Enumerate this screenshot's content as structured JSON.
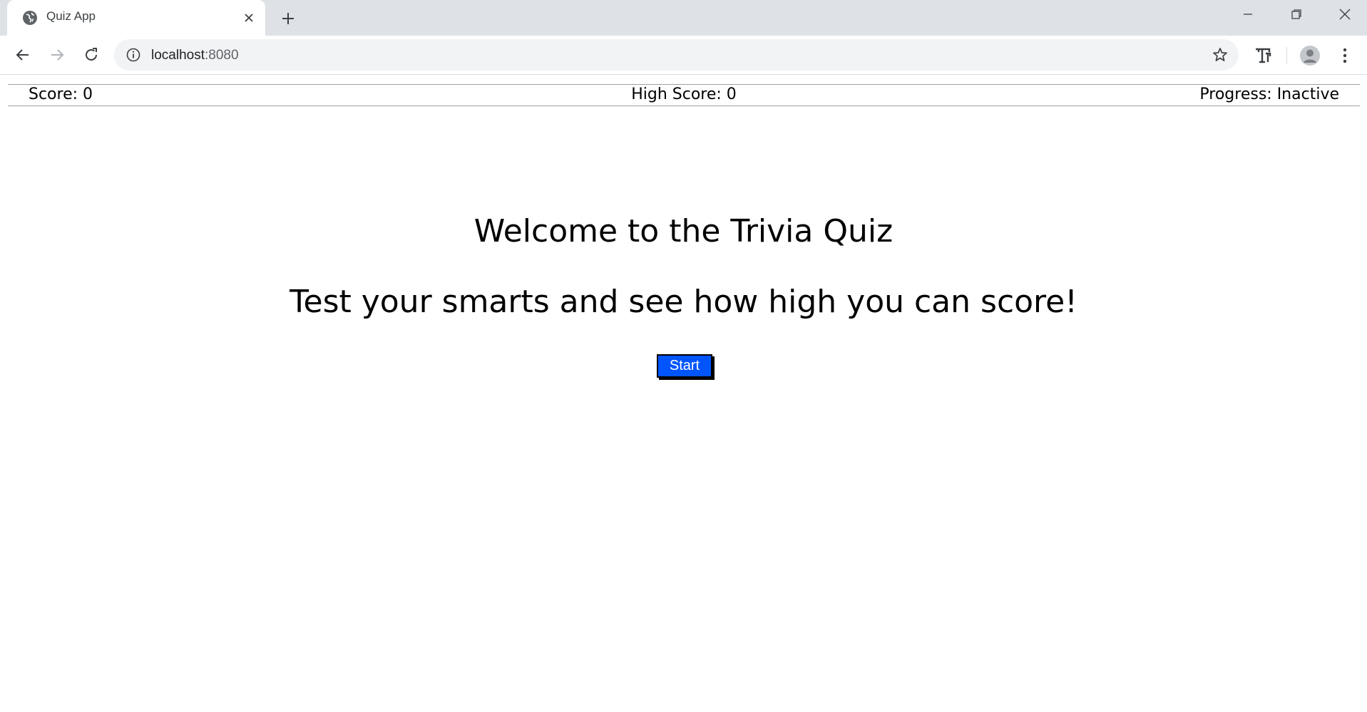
{
  "browser": {
    "tab_title": "Quiz App",
    "url_host": "localhost",
    "url_port": ":8080"
  },
  "status": {
    "score": "Score: 0",
    "high_score": "High Score: 0",
    "progress": "Progress: Inactive"
  },
  "main": {
    "title": "Welcome to the Trivia Quiz",
    "subtitle": "Test your smarts and see how high you can score!",
    "start_label": "Start"
  },
  "colors": {
    "start_button": "#0055ff",
    "tabstrip": "#dee1e6",
    "omnibox": "#f1f3f4"
  }
}
